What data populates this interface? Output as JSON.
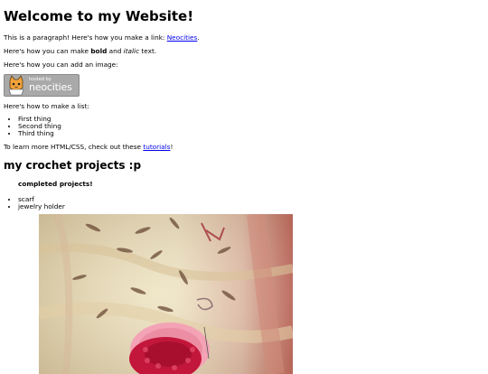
{
  "header": {
    "title": "Welcome to my Website!"
  },
  "intro": {
    "para1_prefix": "This is a paragraph! Here's how you make a link: ",
    "para1_link": "Neocities",
    "para1_suffix": ".",
    "para2_prefix": "Here's how you can make ",
    "para2_bold": "bold",
    "para2_mid": " and ",
    "para2_italic": "italic",
    "para2_suffix": " text.",
    "para3": "Here's how you can add an image:"
  },
  "badge": {
    "small": "hosted by",
    "big": "neocities"
  },
  "list_section": {
    "intro": "Here's how to make a list:",
    "items": [
      "First thing",
      "Second thing",
      "Third thing"
    ]
  },
  "learn": {
    "prefix": "To learn more HTML/CSS, check out these ",
    "link": "tutorials",
    "suffix": "!"
  },
  "crochet": {
    "heading": "my crochet projects :p",
    "completed_label": "completed projects!",
    "items": [
      "scarf",
      "jewelry holder"
    ]
  },
  "colors": {
    "link": "#0000ee",
    "badge_bg": "#a9a9a9",
    "cat_orange": "#f2a33a",
    "fabric": "#e9dcb4",
    "crochet_red": "#c2163a",
    "crochet_pink": "#f3a3b5"
  }
}
